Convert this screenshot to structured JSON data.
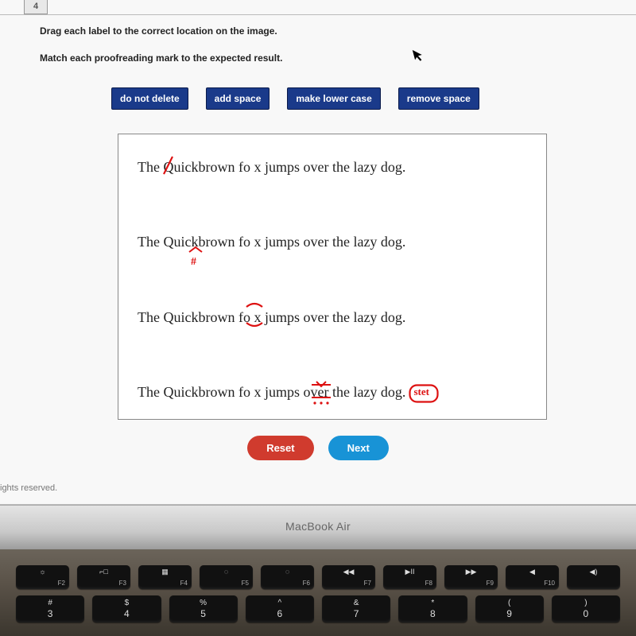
{
  "question_number": "4",
  "instruction1": "Drag each label to the correct location on the image.",
  "instruction2": "Match each proofreading mark to the expected result.",
  "labels": {
    "l1": "do not delete",
    "l2": "add space",
    "l3": "make lower case",
    "l4": "remove space"
  },
  "sentences": {
    "s1a": "The ",
    "s1q": "Q",
    "s1b": "uickbrown fo x jumps over the lazy dog.",
    "s2a": "The Quic",
    "s2k": "k",
    "s2b": "brown fo x jumps over the lazy dog.",
    "s3a": "The Quickbrown f",
    "s3m": "o x",
    "s3b": " jumps over the lazy dog.",
    "s4a": "The Quickbrown fo x jumps o",
    "s4m": "ver",
    "s4b": " the lazy dog.",
    "s4stet": "stet"
  },
  "buttons": {
    "reset": "Reset",
    "next": "Next"
  },
  "footer": "ights reserved.",
  "laptop_label": "MacBook Air",
  "fnkeys": [
    {
      "glyph": "☼",
      "label": "F2"
    },
    {
      "glyph": "⌐□",
      "label": "F3"
    },
    {
      "glyph": "▦",
      "label": "F4"
    },
    {
      "glyph": "◌",
      "label": "F5"
    },
    {
      "glyph": "◌",
      "label": "F6"
    },
    {
      "glyph": "◀◀",
      "label": "F7"
    },
    {
      "glyph": "▶II",
      "label": "F8"
    },
    {
      "glyph": "▶▶",
      "label": "F9"
    },
    {
      "glyph": "◀",
      "label": "F10"
    },
    {
      "glyph": "◀)",
      "label": ""
    }
  ],
  "numkeys": [
    {
      "symbol": "#",
      "digit": "3"
    },
    {
      "symbol": "$",
      "digit": "4"
    },
    {
      "symbol": "%",
      "digit": "5"
    },
    {
      "symbol": "^",
      "digit": "6"
    },
    {
      "symbol": "&",
      "digit": "7"
    },
    {
      "symbol": "*",
      "digit": "8"
    },
    {
      "symbol": "(",
      "digit": "9"
    },
    {
      "symbol": ")",
      "digit": "0"
    }
  ]
}
